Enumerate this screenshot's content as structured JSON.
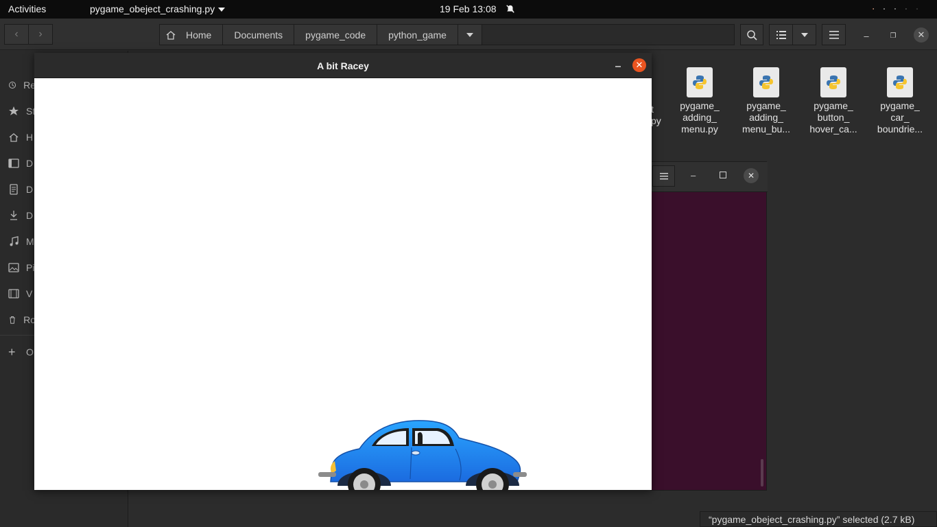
{
  "topbar": {
    "activities": "Activities",
    "app_name": "pygame_obeject_crashing.py",
    "clock": "19 Feb  13:08"
  },
  "files": {
    "path": [
      "Home",
      "Documents",
      "pygame_code",
      "python_game"
    ],
    "sidebar": [
      "Re",
      "St",
      "H",
      "D",
      "D",
      "D",
      "M",
      "Pi",
      "V",
      "Ro",
      "O"
    ],
    "partial_items": [
      "t",
      "py"
    ],
    "items": [
      {
        "name": "pygame_\nadding_\nmenu.py"
      },
      {
        "name": "pygame_\nadding_\nmenu_bu..."
      },
      {
        "name": "pygame_\nbutton_\nhover_ca..."
      },
      {
        "name": "pygame_\ncar_\nboundrie..."
      }
    ],
    "status": "“pygame_obeject_crashing.py” selected  (2.7 kB)"
  },
  "pygame_window": {
    "title": "A bit Racey",
    "car_color": "#1e88f0"
  },
  "terminal": {
    "bg": "#3a0f2b"
  }
}
